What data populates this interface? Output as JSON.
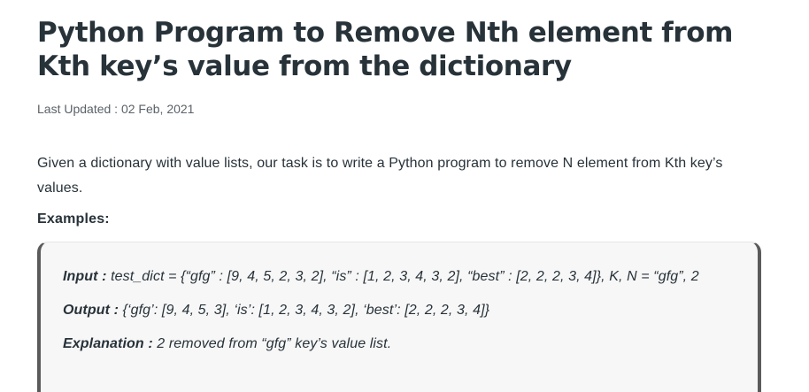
{
  "article": {
    "title": "Python Program to Remove Nth element from Kth key’s value from the dictionary",
    "last_updated": "Last Updated : 02 Feb, 2021",
    "intro": "Given a dictionary with value lists, our task is to write a Python program to remove N element from Kth key’s values.",
    "examples_heading": "Examples:"
  },
  "example": {
    "input_label": "Input :",
    "input_value": " test_dict = {“gfg” : [9, 4, 5, 2, 3, 2], “is” : [1, 2, 3, 4, 3, 2], “best” : [2, 2, 2, 3, 4]}, K, N = “gfg”, 2",
    "output_label": "Output :",
    "output_value": " {‘gfg’: [9, 4, 5, 3], ‘is’: [1, 2, 3, 4, 3, 2], ‘best’: [2, 2, 2, 3, 4]}",
    "explanation_label": "Explanation :",
    "explanation_value": " 2 removed from “gfg” key’s value list."
  }
}
